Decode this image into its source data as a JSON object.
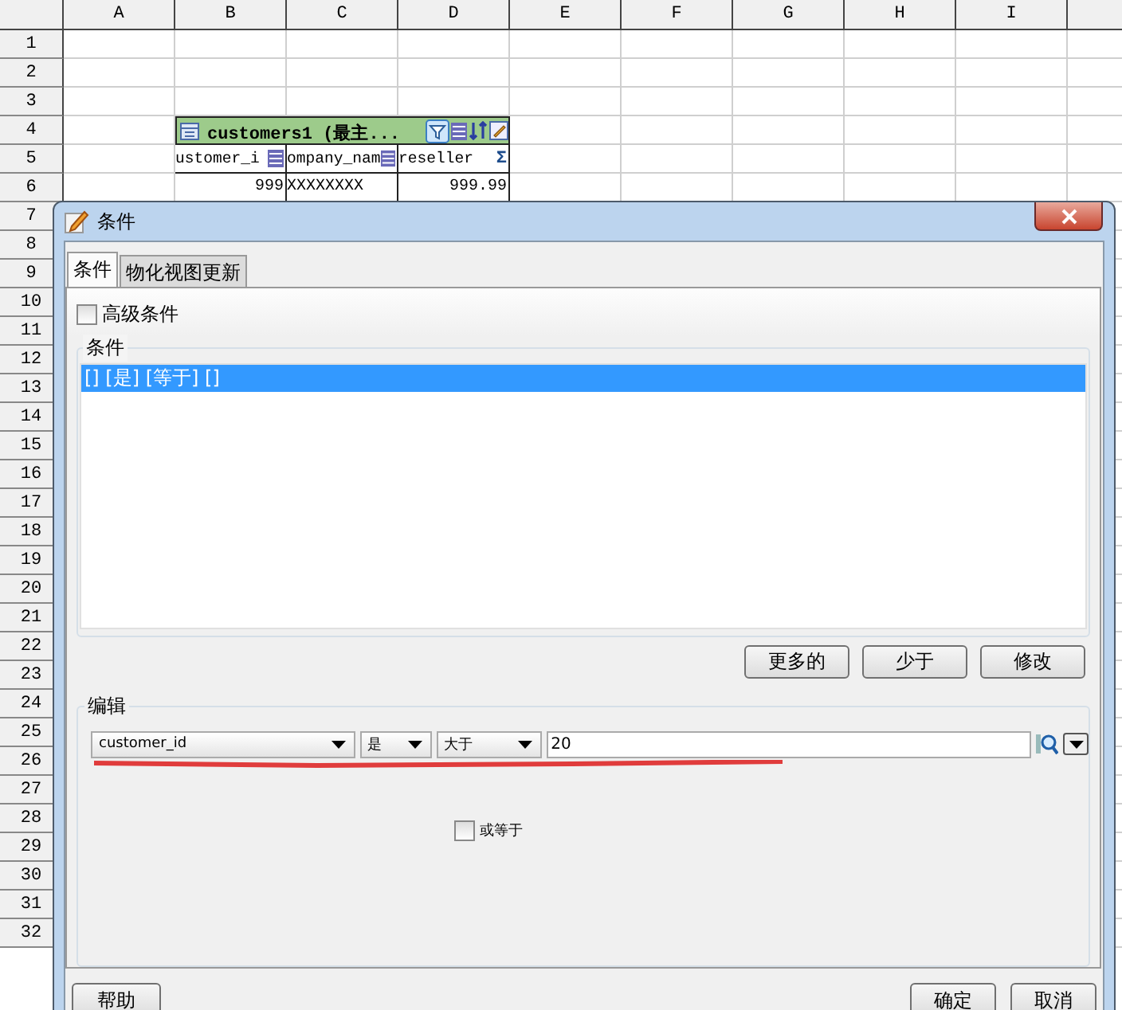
{
  "sheet": {
    "columns": [
      "A",
      "B",
      "C",
      "D",
      "E",
      "F",
      "G",
      "H",
      "I"
    ],
    "rows": [
      "1",
      "2",
      "3",
      "4",
      "5",
      "6",
      "7",
      "8",
      "9",
      "10",
      "11",
      "12",
      "13",
      "14",
      "15",
      "16",
      "17",
      "18",
      "19",
      "20",
      "21",
      "22",
      "23",
      "24",
      "25",
      "26",
      "27",
      "28",
      "29",
      "30",
      "31",
      "32"
    ],
    "table": {
      "title": "customers1 (最主...",
      "columns": [
        {
          "label": "ustomer_i",
          "kind": "list"
        },
        {
          "label": "ompany_nam",
          "kind": "list"
        },
        {
          "label": "reseller",
          "kind": "sum",
          "symbol": "Σ"
        }
      ],
      "values": [
        "999",
        "XXXXXXXX",
        "999.99"
      ]
    }
  },
  "dialog": {
    "title": "条件",
    "tabs": [
      {
        "label": "条件",
        "selected": true
      },
      {
        "label": "物化视图更新",
        "selected": false
      }
    ],
    "advanced": {
      "label": "高级条件",
      "checked": false
    },
    "conditions_group": "条件",
    "conditions": [
      {
        "text": "[] [是] [等于] []",
        "selected": true
      }
    ],
    "list_buttons": [
      "更多的",
      "少于",
      "修改"
    ],
    "edit_group": "编辑",
    "combos": [
      {
        "value": "customer_id"
      },
      {
        "value": "是"
      },
      {
        "value": "大于"
      }
    ],
    "value_field": {
      "value": "20"
    },
    "or_equal": {
      "label": "或等于",
      "checked": false
    },
    "help_button": "帮助",
    "buttons": [
      "确定",
      "取消"
    ]
  }
}
